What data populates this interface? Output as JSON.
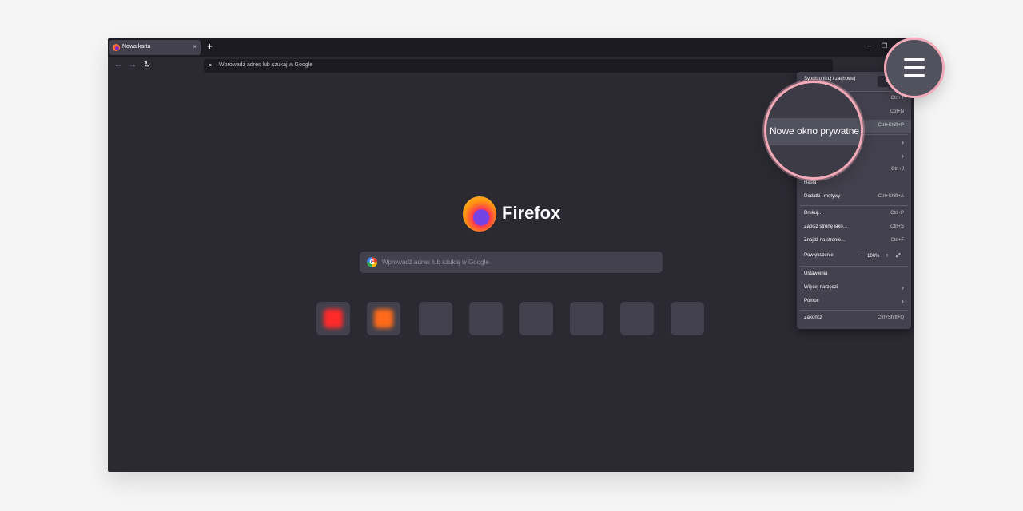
{
  "tab": {
    "title": "Nowa karta",
    "close": "×"
  },
  "new_tab_button": "+",
  "window_controls": {
    "minimize": "–",
    "restore": "❐"
  },
  "nav": {
    "back": "←",
    "forward": "→",
    "reload": "↻"
  },
  "urlbar": {
    "search_icon": "⌕",
    "placeholder": "Wprowadź adres lub szukaj w Google"
  },
  "home": {
    "brand": "Firefox",
    "search_placeholder": "Wprowadź adres lub szukaj w Google",
    "google_icon": "G",
    "shortcuts": [
      {
        "label": "",
        "color": "#ff2a2a"
      },
      {
        "label": "",
        "color": "#ff6a1a"
      },
      {
        "label": "",
        "color": ""
      },
      {
        "label": "",
        "color": ""
      },
      {
        "label": "",
        "color": ""
      },
      {
        "label": "",
        "color": ""
      },
      {
        "label": "",
        "color": ""
      },
      {
        "label": "",
        "color": ""
      }
    ]
  },
  "menu": {
    "sync_label": "Synchronizuj i zachowuj",
    "sync_button": "Zaloguj",
    "items": [
      {
        "label": "",
        "shortcut": "Ctrl+T"
      },
      {
        "label": "",
        "shortcut": "Ctrl+N"
      },
      {
        "label": "",
        "shortcut": "Ctrl+Shift+P"
      },
      {
        "label": "",
        "arrow": "›"
      },
      {
        "label": "",
        "arrow": "›"
      },
      {
        "label": "",
        "shortcut": "Ctrl+J"
      },
      {
        "label": "Hasła",
        "shortcut": ""
      },
      {
        "label": "Dodatki i motywy",
        "shortcut": "Ctrl+Shift+A"
      },
      {
        "label": "Drukuj…",
        "shortcut": "Ctrl+P"
      },
      {
        "label": "Zapisz stronę jako…",
        "shortcut": "Ctrl+S"
      },
      {
        "label": "Znajdź na stronie…",
        "shortcut": "Ctrl+F"
      },
      {
        "label": "Powiększenie",
        "zoom_minus": "−",
        "zoom_value": "100%",
        "zoom_plus": "+",
        "fullscreen": "⤢"
      },
      {
        "label": "Ustawienia",
        "shortcut": ""
      },
      {
        "label": "Więcej narzędzi",
        "arrow": "›"
      },
      {
        "label": "Pomoc",
        "arrow": "›"
      },
      {
        "label": "Zakończ",
        "shortcut": "Ctrl+Shift+Q"
      }
    ]
  },
  "callout": {
    "magnified_label": "Nowe okno prywatne"
  },
  "colors": {
    "accent_ring": "#f2a9b8",
    "window_bg": "#2b2a33",
    "menu_bg": "#42414d"
  }
}
